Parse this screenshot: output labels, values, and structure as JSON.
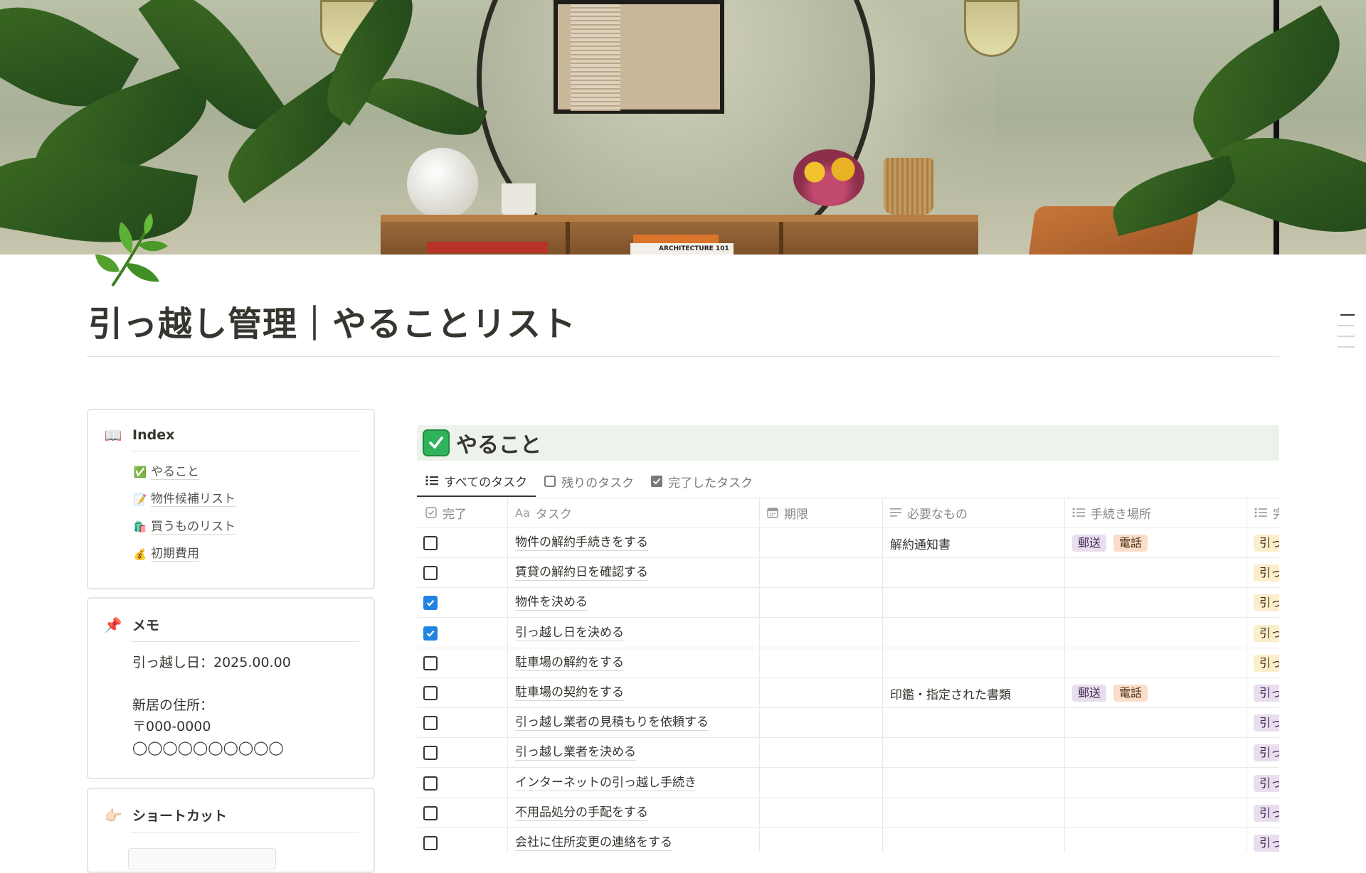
{
  "page": {
    "title": "引っ越し管理｜やることリスト",
    "icon": "leaf-sprig-icon",
    "cover": "interior-plants-shelf-mirror"
  },
  "cover_text": {
    "book_label": "ARCHITECTURE   101"
  },
  "sidebar": {
    "index": {
      "emoji": "📖",
      "title": "Index",
      "items": [
        {
          "icon": "✅",
          "label": "やること"
        },
        {
          "icon": "📝",
          "label": "物件候補リスト"
        },
        {
          "icon": "🛍️",
          "label": "買うものリスト"
        },
        {
          "icon": "💰",
          "label": "初期費用"
        }
      ]
    },
    "memo": {
      "emoji": "📌",
      "title": "メモ",
      "body": "引っ越し日：2025.00.00\n\n新居の住所：\n〒000-0000\n◯◯◯◯◯◯◯◯◯◯"
    },
    "shortcut": {
      "emoji": "👉🏻",
      "title": "ショートカット"
    }
  },
  "database": {
    "emoji": "✅",
    "title": "やること",
    "views": [
      {
        "icon": "list-icon",
        "label": "すべてのタスク",
        "active": true
      },
      {
        "icon": "checkbox-empty-icon",
        "label": "残りのタスク",
        "active": false
      },
      {
        "icon": "checkbox-checked-icon",
        "label": "完了したタスク",
        "active": false
      }
    ],
    "columns": [
      {
        "icon": "checkbox-icon",
        "label": "完了"
      },
      {
        "icon": "text-aa-icon",
        "label": "タスク"
      },
      {
        "icon": "calendar-icon",
        "label": "期限"
      },
      {
        "icon": "text-lines-icon",
        "label": "必要なもの"
      },
      {
        "icon": "multiselect-icon",
        "label": "手続き場所"
      },
      {
        "icon": "multiselect-icon",
        "label": "完"
      }
    ],
    "rows": [
      {
        "done": false,
        "task": "物件の解約手続きをする",
        "due": "",
        "needs": "解約通知書",
        "places": [
          "郵送",
          "電話"
        ],
        "stage": "引っ",
        "stage_color": "yellow"
      },
      {
        "done": false,
        "task": "賃貸の解約日を確認する",
        "due": "",
        "needs": "",
        "places": [],
        "stage": "引っ",
        "stage_color": "yellow"
      },
      {
        "done": true,
        "task": "物件を決める",
        "due": "",
        "needs": "",
        "places": [],
        "stage": "引っ",
        "stage_color": "yellow"
      },
      {
        "done": true,
        "task": "引っ越し日を決める",
        "due": "",
        "needs": "",
        "places": [],
        "stage": "引っ",
        "stage_color": "yellow"
      },
      {
        "done": false,
        "task": "駐車場の解約をする",
        "due": "",
        "needs": "",
        "places": [],
        "stage": "引っ",
        "stage_color": "yellow"
      },
      {
        "done": false,
        "task": "駐車場の契約をする",
        "due": "",
        "needs": "印鑑・指定された書類",
        "places": [
          "郵送",
          "電話"
        ],
        "stage": "引っ",
        "stage_color": "purple"
      },
      {
        "done": false,
        "task": "引っ越し業者の見積もりを依頼する",
        "due": "",
        "needs": "",
        "places": [],
        "stage": "引っ",
        "stage_color": "purple"
      },
      {
        "done": false,
        "task": "引っ越し業者を決める",
        "due": "",
        "needs": "",
        "places": [],
        "stage": "引っ",
        "stage_color": "purple"
      },
      {
        "done": false,
        "task": "インターネットの引っ越し手続き",
        "due": "",
        "needs": "",
        "places": [],
        "stage": "引っ",
        "stage_color": "purple"
      },
      {
        "done": false,
        "task": "不用品処分の手配をする",
        "due": "",
        "needs": "",
        "places": [],
        "stage": "引っ",
        "stage_color": "purple"
      },
      {
        "done": false,
        "task": "会社に住所変更の連絡をする",
        "due": "",
        "needs": "",
        "places": [],
        "stage": "引っ",
        "stage_color": "purple"
      }
    ]
  },
  "colors": {
    "accent_blue": "#2383e2",
    "db_header_bg": "#edf2ec",
    "tag_mail_bg": "#e8deee",
    "tag_tel_bg": "#fadec9",
    "tag_yellow_bg": "#fbeecb"
  }
}
